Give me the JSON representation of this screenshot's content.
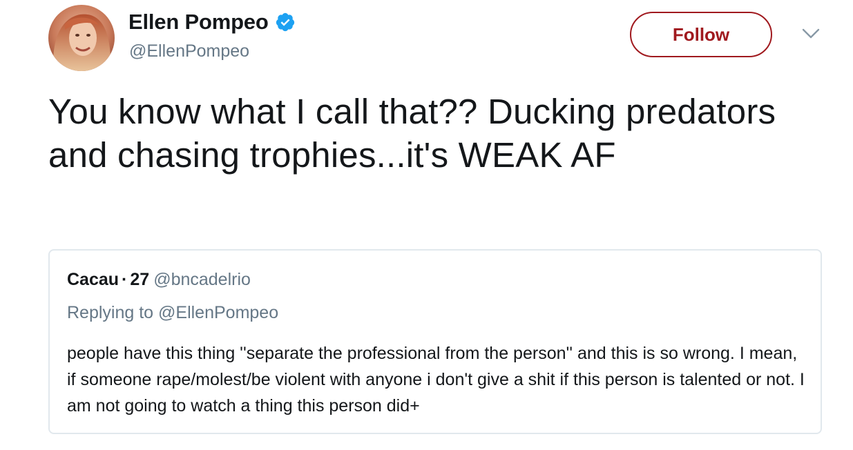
{
  "author": {
    "display_name": "Ellen Pompeo",
    "handle": "@EllenPompeo",
    "verified": true
  },
  "follow_button": {
    "label": "Follow"
  },
  "tweet": {
    "text": "You know what I call that?? Ducking predators and chasing trophies...it's WEAK AF"
  },
  "quoted_tweet": {
    "display_name": "Cacau",
    "separator": "·",
    "age": "27",
    "handle": "@bncadelrio",
    "replying_to": "Replying to @EllenPompeo",
    "text": "people have this thing ''separate the professional from the person'' and this is so wrong. I mean, if someone rape/molest/be violent with anyone i don't give a shit if this person is talented or not. I am not going to watch a thing this person did+"
  },
  "icons": {
    "verified": "verified-badge-icon",
    "more": "chevron-down-icon"
  },
  "colors": {
    "follow_accent": "#a0191e",
    "verified_blue": "#1da1f2",
    "secondary_text": "#657786",
    "primary_text": "#14171a",
    "card_border": "#e1e8ed"
  }
}
